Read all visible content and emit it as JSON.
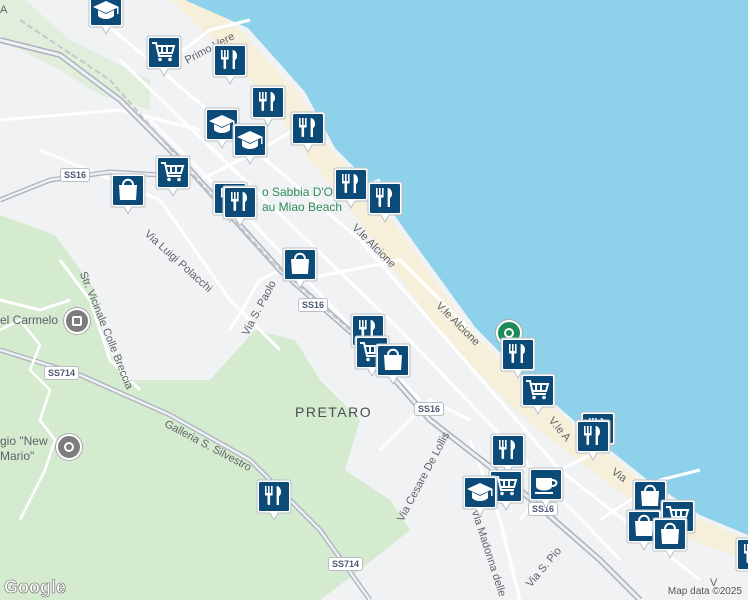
{
  "map": {
    "place_labels": {
      "pretaro": "PRETARO",
      "carmelo": "el Carmelo",
      "beach_1": "o Sabbia D'O",
      "beach_2": "au Miao Beach",
      "new_mario_1": "gio \"New",
      "new_mario_2": "Mario\""
    },
    "street_labels": {
      "primo_vere": "Primo Vere",
      "luigi_polacchi": "Via Luigi Polacchi",
      "alcione_1": "V.le Alcione",
      "alcione_2": "V.le Alcione",
      "colle_breccia": "Str. Vicinale Colle Breccia",
      "san_paolo": "Via S. Paolo",
      "galleria": "Galleria S. Silvestro",
      "cesare_de_lollis": "Via Cesare De Lollis",
      "madonna": "Via Madonna delle",
      "san_pio": "Via S. Pio",
      "viale_short_1": "V.le A",
      "viale_short_2": "Via",
      "viale_short_3": "V"
    },
    "road_shields": {
      "ss16_a": "SS16",
      "ss16_b": "SS16",
      "ss16_c": "SS16",
      "ss16_d": "SS16",
      "ss714_a": "SS714",
      "ss714_b": "SS714"
    },
    "corner_letter": "A",
    "attribution": "Map data ©2025",
    "logo": "Google"
  },
  "marker_icons": [
    "restaurant-icon",
    "shopping-cart-icon",
    "shopping-bag-icon",
    "school-icon",
    "cafe-icon"
  ],
  "colors": {
    "sea": "#8ed1ea",
    "land": "#f1f2f4",
    "green_area": "#cfe8c9",
    "marker": "#0c4a78",
    "highway": "#aab2bd"
  }
}
